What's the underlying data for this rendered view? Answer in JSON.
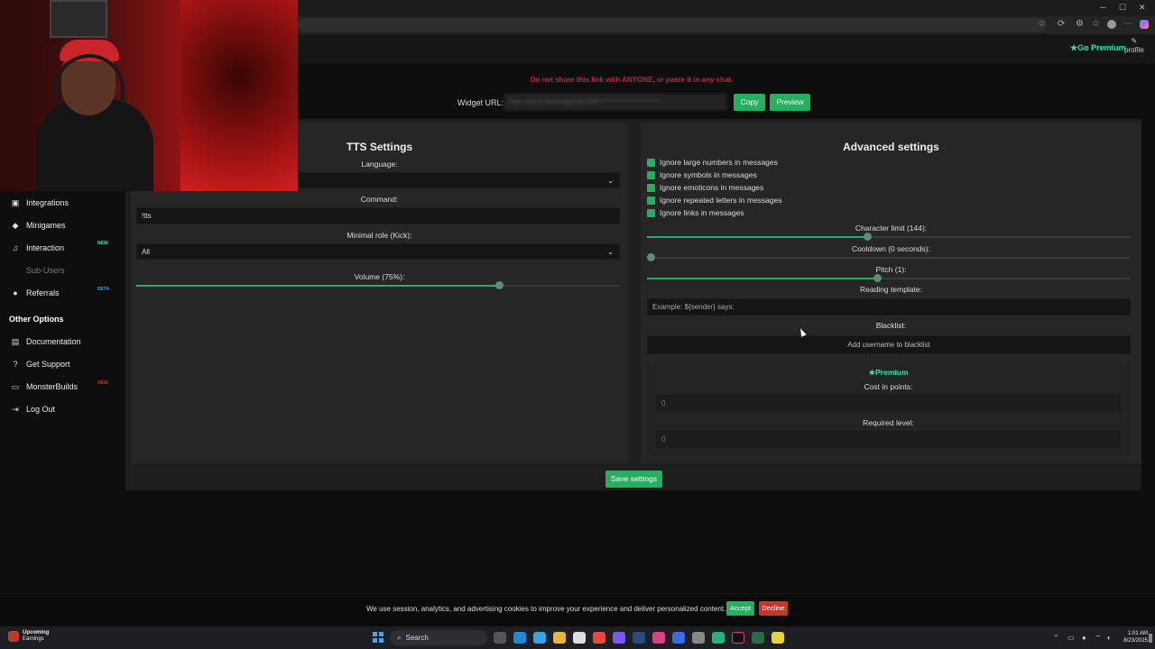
{
  "browser": {
    "window_controls": [
      "─",
      "☐",
      "✕"
    ],
    "toolbar_icons": [
      "star-icon",
      "refresh-icon",
      "extension-icon",
      "favorites-icon",
      "avatar",
      "menu-icon",
      "copilot-icon"
    ]
  },
  "header": {
    "premium_label": "Go Premium",
    "profile_label": "profile"
  },
  "widget": {
    "warning": "Do not share this link with ANYONE, or paste it in any chat.",
    "url_label": "Widget URL:",
    "url_value": "https://botrix.live/widgets/tts?bid=************************",
    "copy_label": "Copy",
    "preview_label": "Preview"
  },
  "sidebar": {
    "items": [
      {
        "label": "Integrations",
        "icon": "integrations-icon",
        "badge": ""
      },
      {
        "label": "Minigames",
        "icon": "gamepad-icon",
        "badge": ""
      },
      {
        "label": "Interaction",
        "icon": "music-icon",
        "badge": "NEW"
      },
      {
        "label": "Sub-Users",
        "icon": "",
        "badge": ""
      },
      {
        "label": "Referrals",
        "icon": "users-icon",
        "badge": "BETA"
      }
    ],
    "other_heading": "Other Options",
    "other_items": [
      {
        "label": "Documentation",
        "icon": "document-icon",
        "badge": ""
      },
      {
        "label": "Get Support",
        "icon": "help-icon",
        "badge": ""
      },
      {
        "label": "MonsterBuilds",
        "icon": "laptop-icon",
        "badge": "NEW"
      },
      {
        "label": "Log Out",
        "icon": "logout-icon",
        "badge": ""
      }
    ]
  },
  "tts": {
    "title": "TTS Settings",
    "language_label": "Language:",
    "language_value": "",
    "command_label": "Command:",
    "command_value": "!tts",
    "role_label": "Minimal role (Kick):",
    "role_value": "All",
    "volume_label": "Volume (75%):",
    "volume_percent": 75
  },
  "advanced": {
    "title": "Advanced settings",
    "checkboxes": [
      {
        "label": "Ignore large numbers in messages",
        "checked": true
      },
      {
        "label": "Ignore symbols in messages",
        "checked": true
      },
      {
        "label": "Ignore emoticons in messages",
        "checked": true
      },
      {
        "label": "Ignore repeated letters in messages",
        "checked": true
      },
      {
        "label": "Ignore links in messages",
        "checked": true
      }
    ],
    "char_limit_label": "Character limit (144):",
    "char_limit_fraction": 0.456,
    "cooldown_label": "Cooldown (0 seconds):",
    "cooldown_fraction": 0,
    "pitch_label": "Pitch (1):",
    "pitch_fraction": 0.476,
    "template_label": "Reading template:",
    "template_placeholder": "Example: ${sender} says:",
    "blacklist_label": "Blacklist:",
    "blacklist_placeholder": "Add username to blacklist",
    "premium_title": "Premium",
    "cost_label": "Cost in points:",
    "cost_value": "0",
    "level_label": "Required level:",
    "level_value": "0"
  },
  "save_label": "Save settings",
  "cookie": {
    "text": "We use session, analytics, and advertising cookies to improve your experience and deliver personalized content.",
    "accept_label": "Accept",
    "decline_label": "Decline"
  },
  "taskbar": {
    "weather_title": "Upcoming",
    "weather_sub": "Earnings",
    "search_label": "Search",
    "time": "1:01 AM",
    "date": "8/23/2025"
  },
  "colors": {
    "accent": "#27ae60",
    "warning": "#c0253c",
    "premium": "#2ee6b3",
    "decline": "#c0392b"
  }
}
